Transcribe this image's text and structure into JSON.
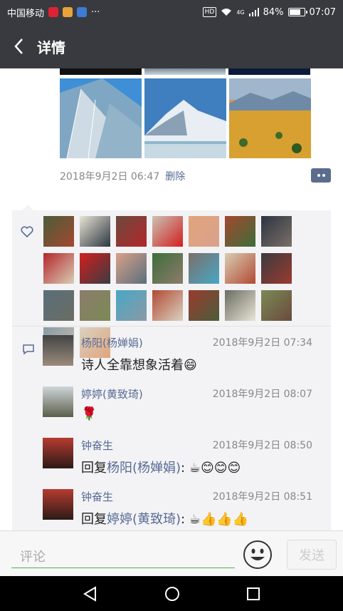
{
  "status_bar": {
    "carrier": "中国移动",
    "network": "4G",
    "hd": "HD",
    "battery": "84%",
    "battery_level": 0.84,
    "time": "07:07",
    "more": "···"
  },
  "header": {
    "title": "详情"
  },
  "post": {
    "date": "2018年9月2日 06:47",
    "delete_label": "删除"
  },
  "likes": {
    "icon": "heart-icon",
    "avatar_count": 25
  },
  "comments": [
    {
      "name": "杨阳(杨婵娟)",
      "time": "2018年9月2日 07:34",
      "text": "诗人全靠想象活着",
      "emoji": "😄"
    },
    {
      "name": "婷婷(黄致琦)",
      "time": "2018年9月2日 08:07",
      "text": "",
      "emoji": "🌹"
    },
    {
      "name": "钟奋生",
      "time": "2018年9月2日 08:50",
      "reply_prefix": "回复",
      "reply_to": "杨阳(杨婵娟)",
      "after": ": ",
      "emoji": "☕😊😊😊"
    },
    {
      "name": "钟奋生",
      "time": "2018年9月2日 08:51",
      "reply_prefix": "回复",
      "reply_to": "婷婷(黄致琦)",
      "after": ": ",
      "emoji": "☕👍👍👍"
    }
  ],
  "input": {
    "placeholder": "评论",
    "send_label": "发送"
  },
  "colors": {
    "bar": "#393a3f",
    "link": "#576b95",
    "input_underline": "#4caf50"
  }
}
